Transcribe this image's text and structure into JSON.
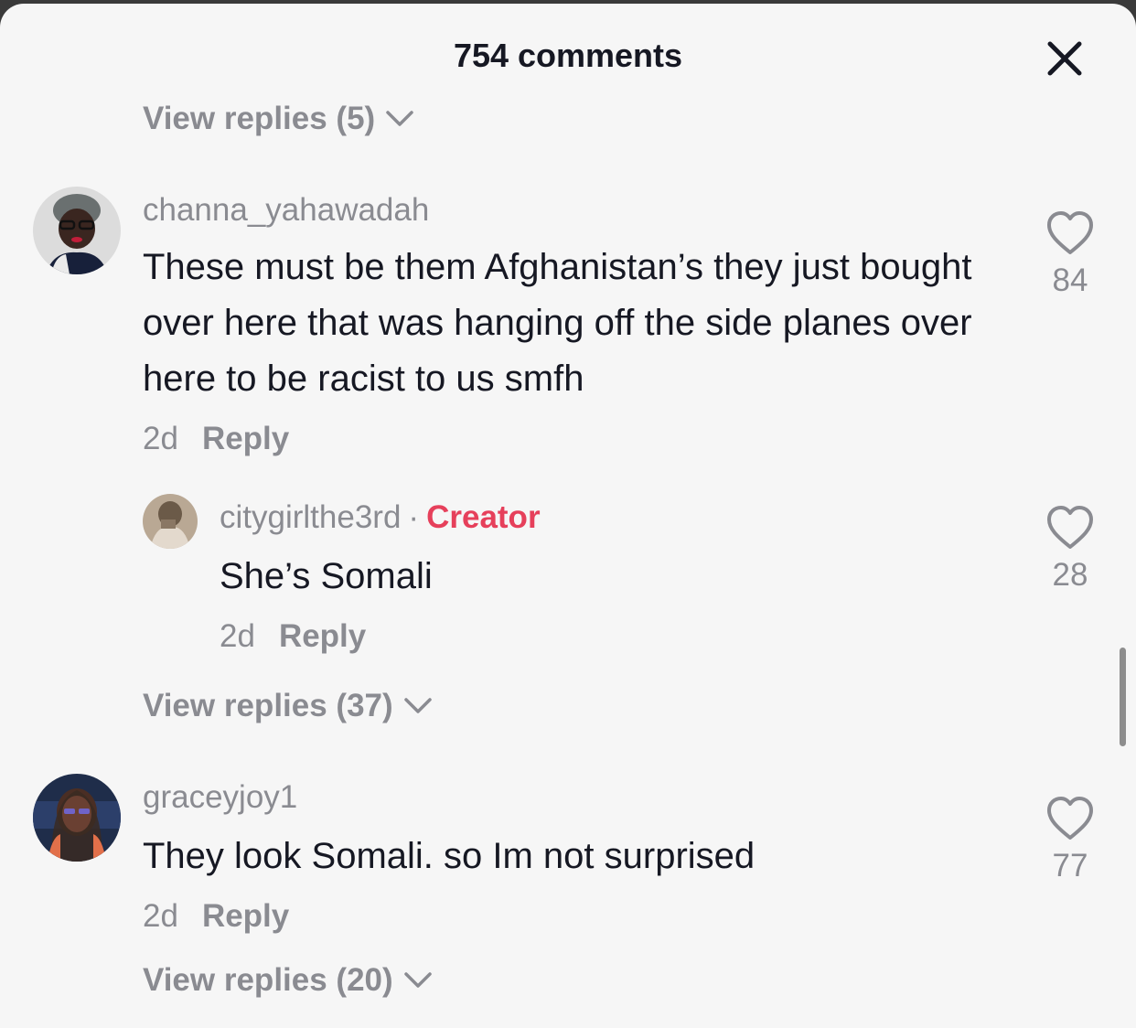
{
  "header": {
    "title": "754 comments",
    "close_icon": "close-icon"
  },
  "top_view_replies": "View replies (5)",
  "comments": [
    {
      "username": "channa_yahawadah",
      "text": "These must be them Afghanistan’s they just bought over here that was hanging off the side planes over here to be racist to us smfh",
      "time": "2d",
      "reply_label": "Reply",
      "likes": "84",
      "replies": [
        {
          "username": "citygirlthe3rd",
          "badge": "Creator",
          "separator": "·",
          "text": "She’s Somali",
          "time": "2d",
          "reply_label": "Reply",
          "likes": "28"
        }
      ],
      "view_replies": "View replies (37)"
    },
    {
      "username": "graceyjoy1",
      "text": "They look Somali. so Im not surprised",
      "time": "2d",
      "reply_label": "Reply",
      "likes": "77",
      "view_replies": "View replies (20)"
    }
  ],
  "colors": {
    "creator": "#e6405b",
    "muted": "#8a8b91",
    "text": "#161823",
    "sheet": "#f6f6f6"
  }
}
